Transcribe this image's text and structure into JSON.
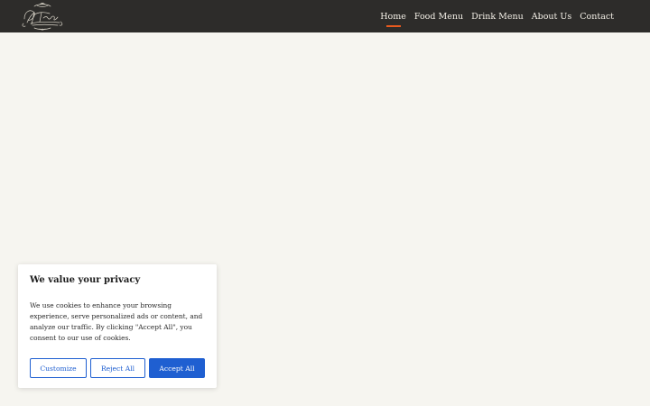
{
  "nav": {
    "items": [
      {
        "label": "Home",
        "active": true
      },
      {
        "label": "Food Menu",
        "active": false
      },
      {
        "label": "Drink Menu",
        "active": false
      },
      {
        "label": "About Us",
        "active": false
      },
      {
        "label": "Contact",
        "active": false
      }
    ],
    "active_color": "#e85a1e"
  },
  "logo": {
    "icon": "ornate-script-logo"
  },
  "cookie_banner": {
    "title": "We value your privacy",
    "text": "We use cookies to enhance your browsing experience, serve personalized ads or content, and analyze our traffic. By clicking \"Accept All\", you consent to our use of cookies.",
    "buttons": {
      "customize": "Customize",
      "reject": "Reject All",
      "accept": "Accept All"
    },
    "accent_color": "#1f5fd1"
  },
  "colors": {
    "header_bg": "#2d2c2a",
    "page_bg": "#f6f5f0"
  }
}
